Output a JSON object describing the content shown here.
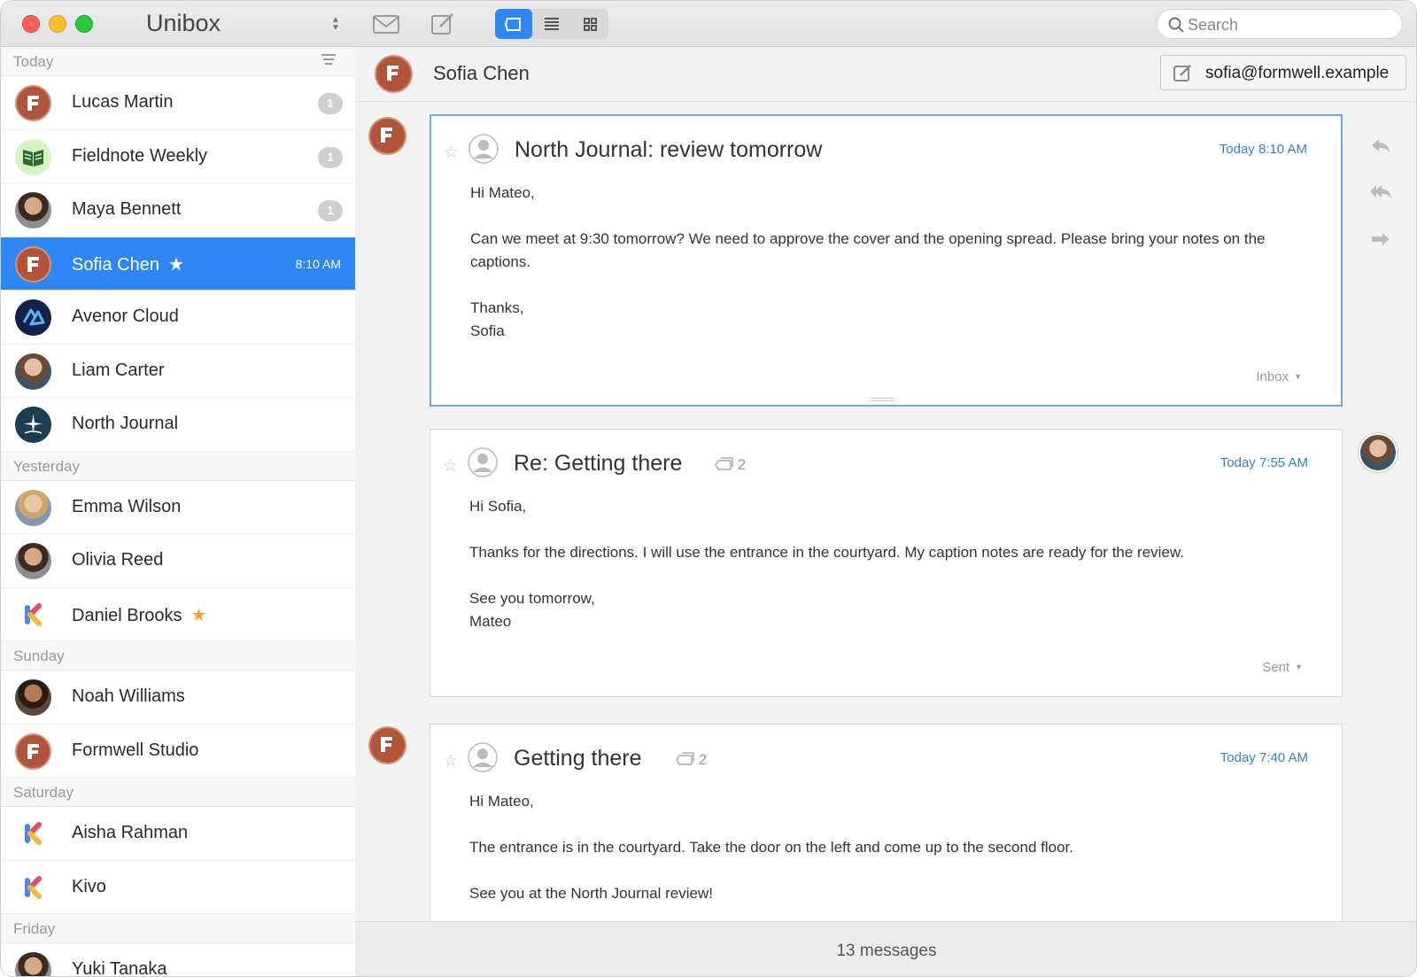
{
  "app": {
    "title": "Unibox"
  },
  "toolbar": {
    "search_placeholder": "Search"
  },
  "sidebar": {
    "groups": [
      {
        "label": "Today",
        "items": [
          {
            "name": "Lucas Martin",
            "badge": "1"
          },
          {
            "name": "Fieldnote Weekly",
            "badge": "1"
          },
          {
            "name": "Maya Bennett",
            "badge": "1"
          },
          {
            "name": "Sofia Chen",
            "time": "8:10 AM",
            "selected": true,
            "starred": true
          },
          {
            "name": "Avenor Cloud"
          },
          {
            "name": "Liam Carter"
          },
          {
            "name": "North Journal"
          }
        ]
      },
      {
        "label": "Yesterday",
        "items": [
          {
            "name": "Emma Wilson"
          },
          {
            "name": "Olivia Reed"
          },
          {
            "name": "Daniel Brooks",
            "starred": true
          }
        ]
      },
      {
        "label": "Sunday",
        "items": [
          {
            "name": "Noah Williams"
          },
          {
            "name": "Formwell Studio"
          }
        ]
      },
      {
        "label": "Saturday",
        "items": [
          {
            "name": "Aisha Rahman"
          },
          {
            "name": "Kivo"
          }
        ]
      },
      {
        "label": "Friday",
        "items": [
          {
            "name": "Yuki Tanaka"
          }
        ]
      }
    ]
  },
  "conversation": {
    "contact_name": "Sofia Chen",
    "contact_email": "sofia@formwell.example",
    "messages": [
      {
        "subject": "North Journal: review tomorrow",
        "date": "Today 8:10 AM",
        "body": [
          "Hi Mateo,",
          "Can we meet at 9:30 tomorrow? We need to approve the cover and the opening spread. Please bring your notes on the captions.",
          "Thanks,\nSofia"
        ],
        "folder": "Inbox"
      },
      {
        "subject": "Re: Getting there",
        "thread_count": "2",
        "date": "Today 7:55 AM",
        "body": [
          "Hi Sofia,",
          "Thanks for the directions. I will use the entrance in the courtyard. My caption notes are ready for the review.",
          "See you tomorrow,\nMateo"
        ],
        "folder": "Sent"
      },
      {
        "subject": "Getting there",
        "thread_count": "2",
        "date": "Today 7:40 AM",
        "body": [
          "Hi Mateo,",
          "The entrance is in the courtyard. Take the door on the left and come up to the second floor.",
          "See you at the North Journal review!"
        ]
      }
    ]
  },
  "footer": {
    "count": "13 messages"
  },
  "colors": {
    "accent": "#2f86f6",
    "formwell": "#b0553a",
    "link_date": "#2f7fe0"
  }
}
